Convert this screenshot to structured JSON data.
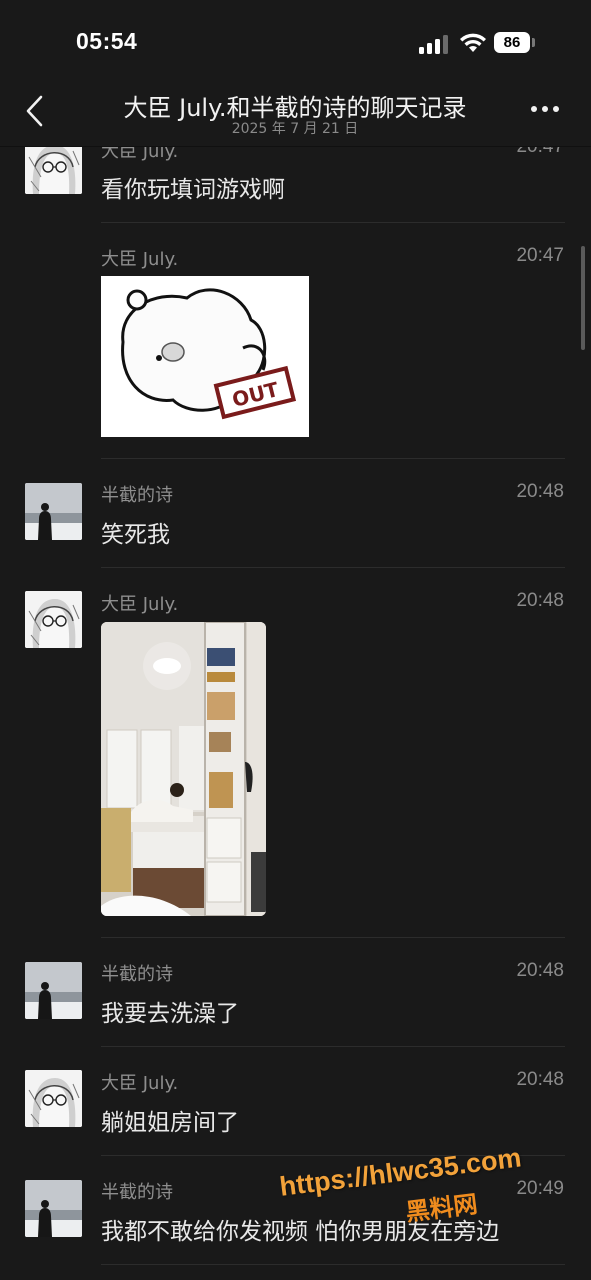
{
  "status_bar": {
    "time": "05:54",
    "battery": "86"
  },
  "nav": {
    "title": "大臣 July.和半截的诗的聊天记录",
    "subtitle": "2025 年 7 月 21 日"
  },
  "messages": [
    {
      "sender": "大臣 July.",
      "time": "20:47",
      "text": "看你玩填词游戏啊",
      "avatar": "girl"
    },
    {
      "sender": "大臣 July.",
      "time": "20:47",
      "image": "sticker",
      "sticker_text": "OUT"
    },
    {
      "sender": "半截的诗",
      "time": "20:48",
      "text": "笑死我",
      "avatar": "man"
    },
    {
      "sender": "大臣 July.",
      "time": "20:48",
      "image": "photo",
      "avatar": "girl"
    },
    {
      "sender": "半截的诗",
      "time": "20:48",
      "text": "我要去洗澡了",
      "avatar": "man"
    },
    {
      "sender": "大臣 July.",
      "time": "20:48",
      "text": "躺姐姐房间了",
      "avatar": "girl"
    },
    {
      "sender": "半截的诗",
      "time": "20:49",
      "text": "我都不敢给你发视频 怕你男朋友在旁边",
      "avatar": "man"
    }
  ],
  "watermark": {
    "url": "https://hlwc35.com",
    "brand": "黑料网"
  },
  "colors": {
    "background": "#191919",
    "divider": "#2c2c2c",
    "secondary_text": "#8e8e8e",
    "watermark": "#f2a23a"
  },
  "icons": [
    "back-chevron-icon",
    "more-dots-icon",
    "cellular-signal-icon",
    "wifi-icon",
    "battery-icon"
  ]
}
